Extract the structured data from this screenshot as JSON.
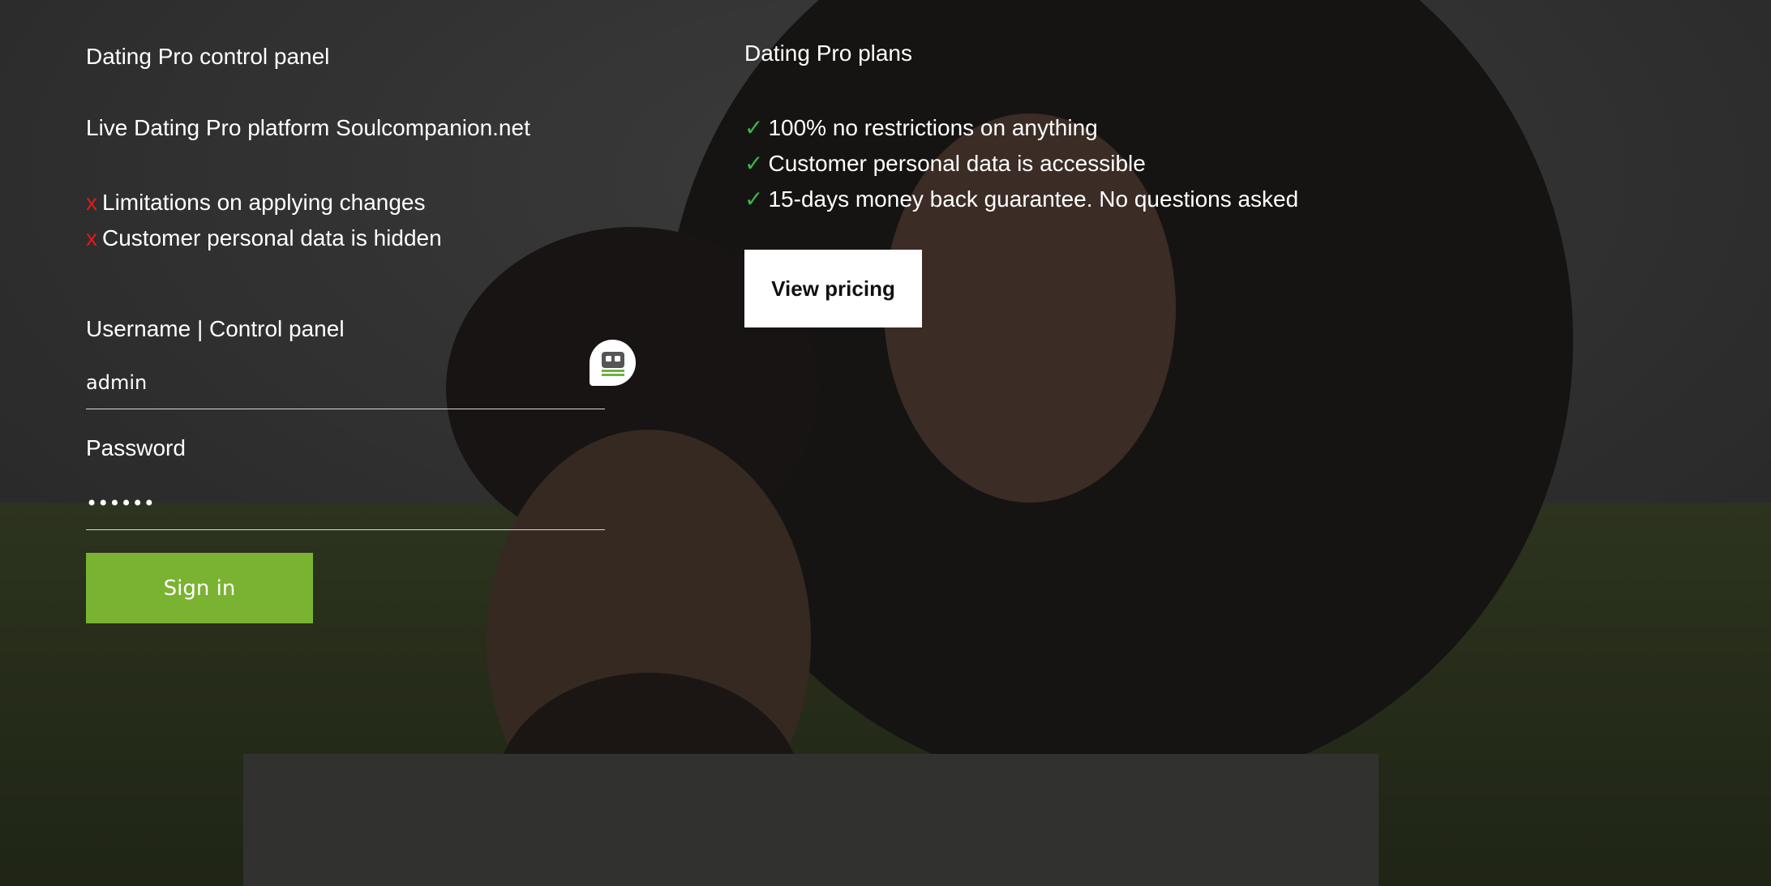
{
  "left": {
    "panel_title": "Dating Pro control panel",
    "platform": "Live Dating Pro platform Soulcompanion.net",
    "limitations": [
      {
        "mark": "x",
        "text": "Limitations on applying changes"
      },
      {
        "mark": "x",
        "text": "Customer personal data is hidden"
      }
    ],
    "username_label": "Username | Control panel",
    "username_value": "admin",
    "password_label": "Password",
    "password_value": "••••••",
    "signin_label": "Sign in"
  },
  "right": {
    "plans_title": "Dating Pro plans",
    "benefits": [
      {
        "mark": "✓",
        "text": "100% no restrictions on anything"
      },
      {
        "mark": "✓",
        "text": "Customer personal data is accessible"
      },
      {
        "mark": "✓",
        "text": "15-days money back guarantee. No questions asked"
      }
    ],
    "pricing_label": "View pricing"
  },
  "chat": {
    "icon": "chat-bot-icon"
  },
  "colors": {
    "accent_green": "#7ab331",
    "check_green": "#3ab54a",
    "cross_red": "#e01b1b"
  }
}
